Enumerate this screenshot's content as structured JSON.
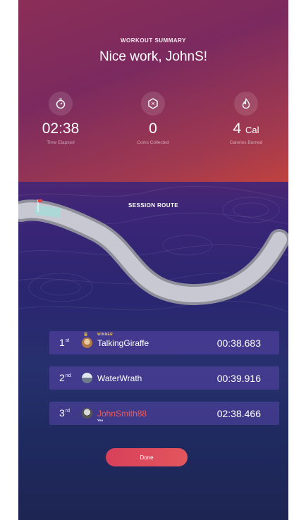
{
  "header": {
    "subtitle": "WORKOUT SUMMARY",
    "title": "Nice work, JohnS!"
  },
  "stats": [
    {
      "icon": "stopwatch-icon",
      "value": "02:38",
      "unit": "",
      "label": "Time Elapsed"
    },
    {
      "icon": "coin-icon",
      "value": "0",
      "unit": "",
      "label": "Coins Collected"
    },
    {
      "icon": "flame-icon",
      "value": "4",
      "unit": "Cal",
      "label": "Calories Burned"
    }
  ],
  "route": {
    "title": "SESSION ROUTE"
  },
  "leaderboard": [
    {
      "place": "1",
      "suffix": "st",
      "name": "TalkingGiraffe",
      "time": "00:38.683",
      "tag": "WINNER"
    },
    {
      "place": "2",
      "suffix": "nd",
      "name": "WaterWrath",
      "time": "00:39.916",
      "tag": ""
    },
    {
      "place": "3",
      "suffix": "rd",
      "name": "JohnSmith88",
      "time": "02:38.466",
      "tag": "You"
    }
  ],
  "done_label": "Done",
  "colors": {
    "accent": "#e2565d",
    "winner": "#f2c84a",
    "self_name": "#ef5a55"
  }
}
